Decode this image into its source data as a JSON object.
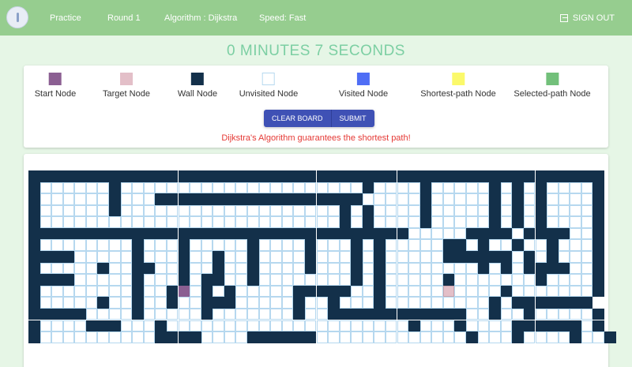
{
  "header": {
    "nav": [
      "Practice",
      "Round 1",
      "Algorithm : Dijkstra",
      "Speed: Fast"
    ],
    "signout_label": "SIGN OUT"
  },
  "timer": "0 MINUTES 7 SECONDS",
  "legend": [
    {
      "label": "Start Node",
      "color": "#8b5f92"
    },
    {
      "label": "Target Node",
      "color": "#e3bfc8"
    },
    {
      "label": "Wall Node",
      "color": "#13304a"
    },
    {
      "label": "Unvisited Node",
      "color": "#ffffff"
    },
    {
      "label": "Visited Node",
      "color": "#4f6ef5"
    },
    {
      "label": "Shortest-path Node",
      "color": "#fbf96a"
    },
    {
      "label": "Selected-path Node",
      "color": "#72c07a"
    }
  ],
  "buttons": {
    "clear": "CLEAR BOARD",
    "submit": "SUBMIT"
  },
  "message": "Dijkstra's Algorithm guarantees the shortest path!",
  "colors": {
    "header": "#96cd8f",
    "accent": "#3f51b5",
    "timer": "#7ccfa3",
    "message": "#e53935"
  },
  "grid": {
    "rows": [
      "##################################################",
      "#......#.....................#....#.....#.#.#....#",
      "#......#...##################.....#.....#.#.#....#",
      "#......#...................#.#....#.....#.#.#....#",
      "#..........................#.#....#.....#.#.#....#",
      "#################################.....####.####..#",
      "#........#...#.....#....#...#.#.....##.#..#..#...#",
      "####.....#...#..#..#....#...#.#.....######.#.#...#",
      "#.....#..##..#..#..#....#...#.#........#.#.####..#",
      "####.....#...#.##..#........#.#.....#.......#....#",
      "#........#..#S.#.#.....#####..#.....T....#.......#",
      "#.....#..#..#..###.....#..#...#.........#.#######",
      "#####....#.....#.......#..############..#..#.....#",
      "#....###...#.....................#...#....######.#",
      "#..........####....######.............#...#....#..#"
    ]
  }
}
